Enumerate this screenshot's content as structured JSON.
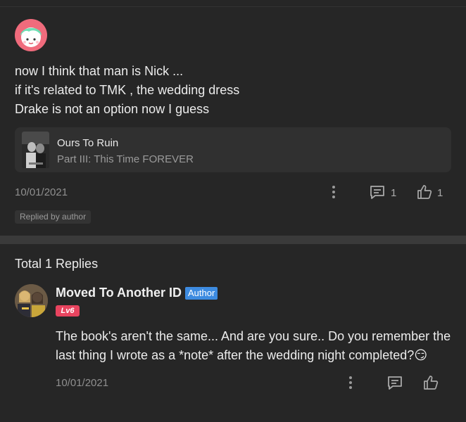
{
  "comment": {
    "lines": [
      "now I think that man is Nick ...",
      "if it's related to TMK , the wedding dress",
      "Drake is not an option now I guess"
    ],
    "book": {
      "title": "Ours To Ruin",
      "subtitle": "Part III: This Time FOREVER"
    },
    "date": "10/01/2021",
    "reply_count": "1",
    "like_count": "1",
    "replied_badge": "Replied by author"
  },
  "replies": {
    "title": "Total 1 Replies",
    "items": [
      {
        "name": "Moved To Another ID",
        "author_badge": "Author",
        "level": "Lv6",
        "text": "The book's aren't the same... And are you sure.. Do you remember the last thing I wrote as a *note* after the wedding night completed?",
        "emoji": "😏",
        "date": "10/01/2021"
      }
    ]
  },
  "colors": {
    "background": "#262626",
    "author_badge": "#3d8be0",
    "level_badge": "#e8445f",
    "avatar_bg": "#f06b7c"
  }
}
